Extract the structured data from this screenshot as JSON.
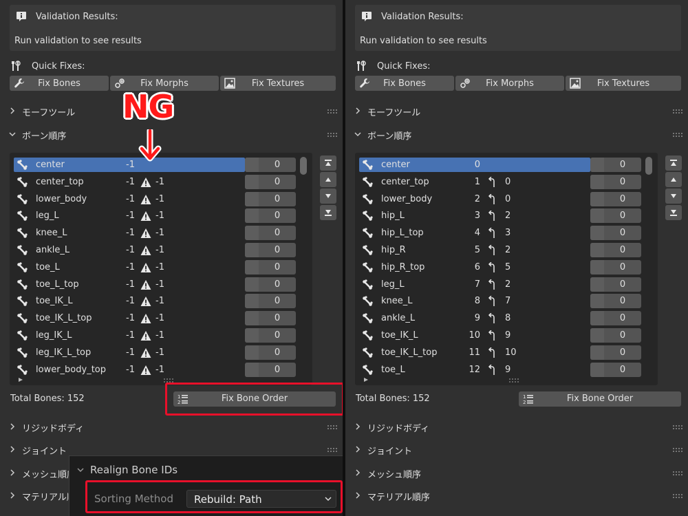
{
  "validation": {
    "title": "Validation Results:",
    "message": "Run validation to see results"
  },
  "quick_fixes": {
    "label": "Quick Fixes:",
    "buttons": {
      "fix_bones": "Fix Bones",
      "fix_morphs": "Fix Morphs",
      "fix_textures": "Fix Textures"
    }
  },
  "sections": {
    "morph_tools": "モーフツール",
    "bone_order": "ボーン順序",
    "rigid_body": "リジッドボディ",
    "joint": "ジョイント",
    "mesh_order": "メッシュ順序",
    "material_order": "マテリアル順序"
  },
  "left_panel": {
    "bones": [
      {
        "name": "center",
        "index": "-1",
        "warning": false,
        "parent": "",
        "value": "0",
        "selected": true
      },
      {
        "name": "center_top",
        "index": "-1",
        "warning": true,
        "parent": "-1",
        "value": "0"
      },
      {
        "name": "lower_body",
        "index": "-1",
        "warning": true,
        "parent": "-1",
        "value": "0"
      },
      {
        "name": "leg_L",
        "index": "-1",
        "warning": true,
        "parent": "-1",
        "value": "0"
      },
      {
        "name": "knee_L",
        "index": "-1",
        "warning": true,
        "parent": "-1",
        "value": "0"
      },
      {
        "name": "ankle_L",
        "index": "-1",
        "warning": true,
        "parent": "-1",
        "value": "0"
      },
      {
        "name": "toe_L",
        "index": "-1",
        "warning": true,
        "parent": "-1",
        "value": "0"
      },
      {
        "name": "toe_L_top",
        "index": "-1",
        "warning": true,
        "parent": "-1",
        "value": "0"
      },
      {
        "name": "toe_IK_L",
        "index": "-1",
        "warning": true,
        "parent": "-1",
        "value": "0"
      },
      {
        "name": "toe_IK_L_top",
        "index": "-1",
        "warning": true,
        "parent": "-1",
        "value": "0"
      },
      {
        "name": "leg_IK_L",
        "index": "-1",
        "warning": true,
        "parent": "-1",
        "value": "0"
      },
      {
        "name": "leg_IK_L_top",
        "index": "-1",
        "warning": true,
        "parent": "-1",
        "value": "0"
      },
      {
        "name": "lower_body_top",
        "index": "-1",
        "warning": true,
        "parent": "-1",
        "value": "0"
      }
    ]
  },
  "right_panel": {
    "bones": [
      {
        "name": "center",
        "index": "0",
        "warning": false,
        "parent": "",
        "value": "0",
        "selected": true
      },
      {
        "name": "center_top",
        "index": "1",
        "parent": "0",
        "value": "0"
      },
      {
        "name": "lower_body",
        "index": "2",
        "parent": "0",
        "value": "0"
      },
      {
        "name": "hip_L",
        "index": "3",
        "parent": "2",
        "value": "0"
      },
      {
        "name": "hip_L_top",
        "index": "4",
        "parent": "3",
        "value": "0"
      },
      {
        "name": "hip_R",
        "index": "5",
        "parent": "2",
        "value": "0"
      },
      {
        "name": "hip_R_top",
        "index": "6",
        "parent": "5",
        "value": "0"
      },
      {
        "name": "leg_L",
        "index": "7",
        "parent": "2",
        "value": "0"
      },
      {
        "name": "knee_L",
        "index": "8",
        "parent": "7",
        "value": "0"
      },
      {
        "name": "ankle_L",
        "index": "9",
        "parent": "8",
        "value": "0"
      },
      {
        "name": "toe_IK_L",
        "index": "10",
        "parent": "9",
        "value": "0"
      },
      {
        "name": "toe_IK_L_top",
        "index": "11",
        "parent": "10",
        "value": "0"
      },
      {
        "name": "toe_L",
        "index": "12",
        "parent": "9",
        "value": "0"
      }
    ]
  },
  "bone_footer": {
    "total": "Total Bones: 152",
    "fix_order_label": "Fix Bone Order"
  },
  "popup": {
    "title": "Realign Bone IDs",
    "sorting_label": "Sorting Method",
    "sorting_value": "Rebuild: Path"
  },
  "annotation": {
    "ng_text": "NG"
  },
  "colors": {
    "panel_bg": "#303030",
    "list_bg": "#262626",
    "selection": "#4772b3",
    "button_bg": "#545454",
    "highlight_red": "#e8102a",
    "ng_red": "#ff1a1a"
  }
}
